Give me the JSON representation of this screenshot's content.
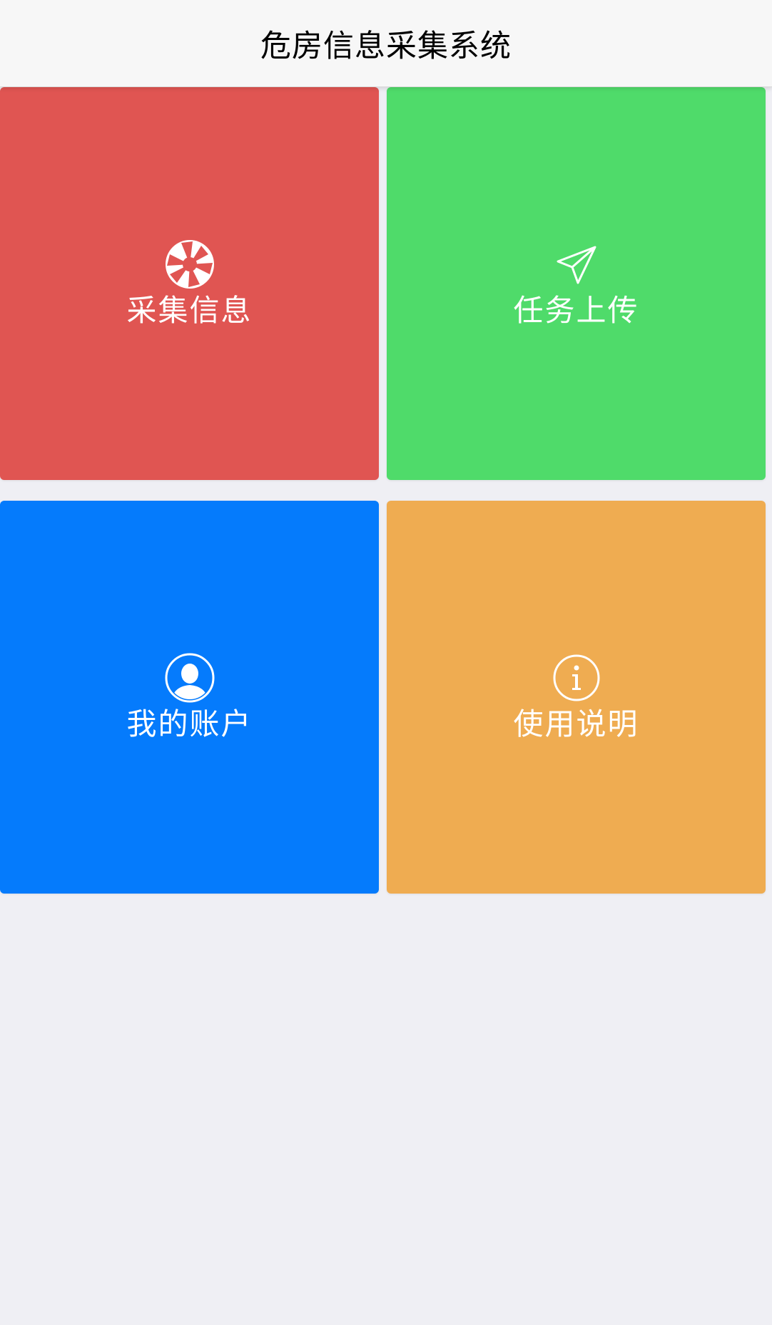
{
  "header": {
    "title": "危房信息采集系统"
  },
  "tiles": [
    {
      "id": "collect",
      "label": "采集信息",
      "icon": "aperture-icon",
      "color": "#e05552"
    },
    {
      "id": "upload",
      "label": "任务上传",
      "icon": "paper-plane-icon",
      "color": "#4fdb6a"
    },
    {
      "id": "account",
      "label": "我的账户",
      "icon": "user-circle-icon",
      "color": "#057bfc"
    },
    {
      "id": "help",
      "label": "使用说明",
      "icon": "info-circle-icon",
      "color": "#efac51"
    }
  ]
}
